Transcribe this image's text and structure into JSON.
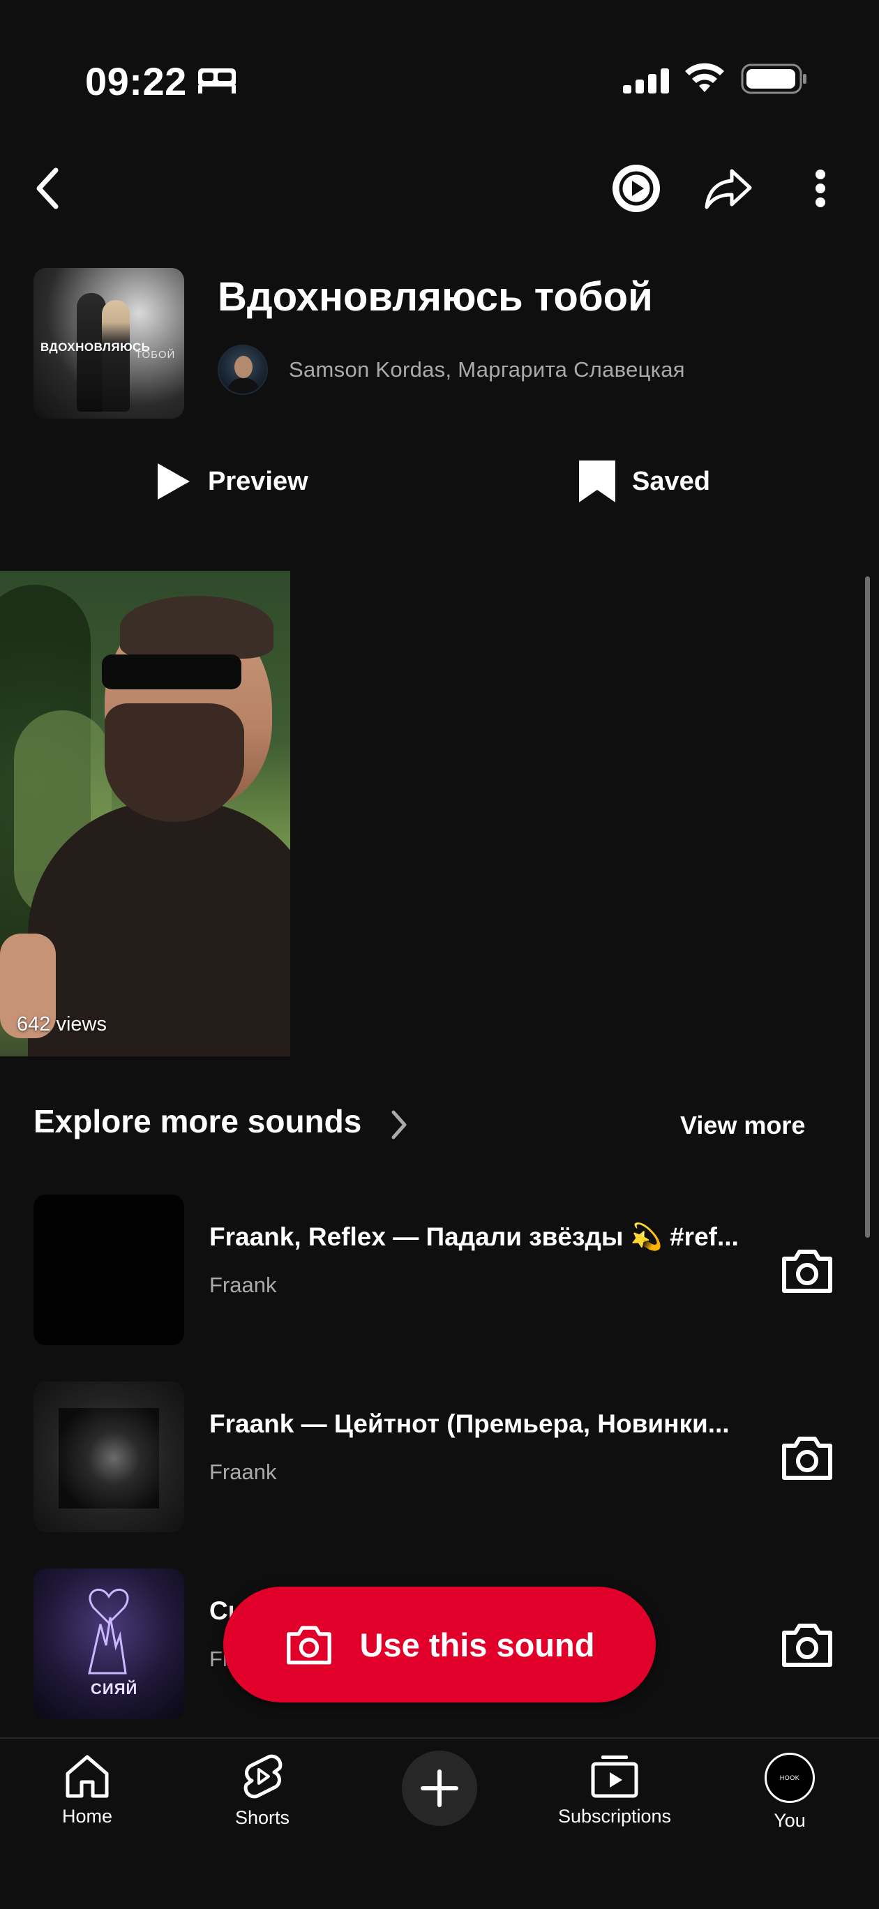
{
  "status_bar": {
    "time": "09:22"
  },
  "top_bar": {
    "icons": [
      "back-icon",
      "play-circle-icon",
      "share-icon",
      "more-vertical-icon"
    ]
  },
  "sound": {
    "title": "Вдохновляюсь тобой",
    "artists": "Samson Kordas, Маргарита Славецкая",
    "cover_text_line1": "ВДОХНОВЛЯЮСЬ",
    "cover_text_line2": "ТОБОЙ",
    "preview_label": "Preview",
    "saved_label": "Saved"
  },
  "videos": [
    {
      "views": "642 views"
    }
  ],
  "explore": {
    "title": "Explore more sounds",
    "view_more_label": "View more",
    "items": [
      {
        "title": "Fraank, Reflex — Падали звёзды 💫 #ref...",
        "artist": "Fraank"
      },
      {
        "title": "Fraank — Цейтнот (Премьера, Новинки...",
        "artist": "Fraank"
      },
      {
        "title": "Си",
        "artist": "Fr",
        "cover_text": "СИЯЙ"
      }
    ]
  },
  "use_sound_button": {
    "label": "Use this sound"
  },
  "bottom_nav": {
    "items": [
      {
        "label": "Home",
        "icon": "home-icon"
      },
      {
        "label": "Shorts",
        "icon": "shorts-icon"
      },
      {
        "label": "",
        "icon": "plus-icon"
      },
      {
        "label": "Subscriptions",
        "icon": "subscriptions-icon"
      },
      {
        "label": "You",
        "icon": "avatar"
      }
    ],
    "you_avatar_text": "HOOK"
  },
  "colors": {
    "background": "#0f0f0f",
    "accent": "#e0002a",
    "secondary_text": "#aaaaaa"
  }
}
